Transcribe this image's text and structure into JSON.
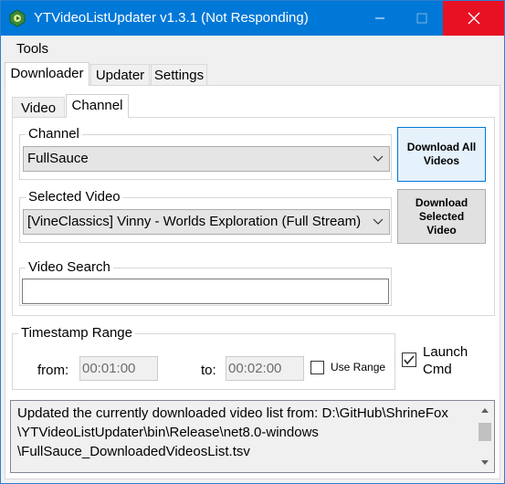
{
  "window": {
    "title": "YTVideoListUpdater v1.3.1 (Not Responding)",
    "title_bar_color": "#0078d7",
    "close_button_color": "#e81123",
    "icons": {
      "app": "app-icon",
      "minimize": "minimize-icon",
      "maximize": "maximize-icon",
      "close": "close-icon"
    }
  },
  "menu": {
    "items": [
      {
        "label": "Tools"
      }
    ]
  },
  "tabs": [
    {
      "label": "Downloader",
      "active": true
    },
    {
      "label": "Updater",
      "active": false
    },
    {
      "label": "Settings",
      "active": false
    }
  ],
  "downloader": {
    "subtabs": [
      {
        "label": "Video",
        "active": false
      },
      {
        "label": "Channel",
        "active": true
      }
    ],
    "channel": {
      "label": "Channel",
      "selected": "FullSauce"
    },
    "selected_video": {
      "label": "Selected Video",
      "selected": "[VineClassics] Vinny - Worlds Exploration (Full Stream)"
    },
    "video_search": {
      "label": "Video Search",
      "value": ""
    },
    "buttons": {
      "download_all": "Download All Videos",
      "download_selected": "Download Selected Video"
    }
  },
  "timestamp_range": {
    "label": "Timestamp Range",
    "from_label": "from:",
    "from_value": "00:01:00",
    "to_label": "to:",
    "to_value": "00:02:00",
    "use_range_label": "Use Range",
    "use_range_checked": false
  },
  "launch_cmd": {
    "label": "Launch Cmd",
    "checked": true
  },
  "log": {
    "lines": [
      "Updated the currently downloaded video list from: D:\\GitHub\\ShrineFox",
      "\\YTVideoListUpdater\\bin\\Release\\net8.0-windows",
      "\\FullSauce_DownloadedVideosList.tsv"
    ]
  }
}
